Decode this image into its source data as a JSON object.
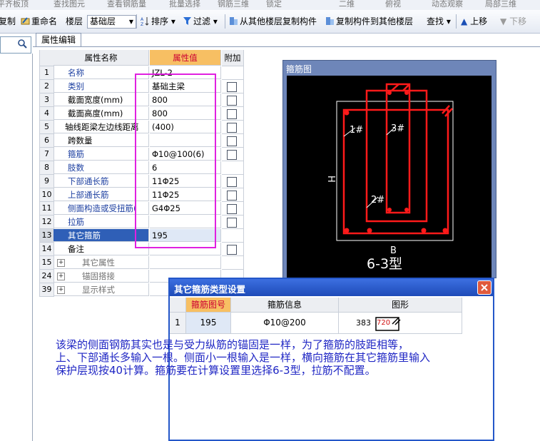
{
  "top_strip": [
    "平齐板顶",
    "查找图元",
    "查看钢筋量",
    "批量选择",
    "钢筋三维",
    "锁定",
    "二维",
    "俯视",
    "动态观察",
    "局部三维"
  ],
  "toolbar": {
    "items": [
      "复制",
      "重命名",
      "楼层",
      "基础层",
      "排序",
      "过滤",
      "从其他楼层复制构件",
      "复制构件到其他楼层",
      "查找",
      "上移",
      "下移"
    ]
  },
  "tab": {
    "label": "属性编辑"
  },
  "grid": {
    "headers": {
      "name": "属性名称",
      "value": "属性值",
      "add": "附加"
    },
    "rows": [
      {
        "num": "1",
        "name": "名称",
        "value": "JZL-2"
      },
      {
        "num": "2",
        "name": "类别",
        "value": "基础主梁"
      },
      {
        "num": "3",
        "name": "截面宽度(mm)",
        "value": "800"
      },
      {
        "num": "4",
        "name": "截面高度(mm)",
        "value": "800"
      },
      {
        "num": "5",
        "name": "轴线距梁左边线距离",
        "value": "(400)"
      },
      {
        "num": "6",
        "name": "跨数量",
        "value": ""
      },
      {
        "num": "7",
        "name": "箍筋",
        "value": "Φ10@100(6)"
      },
      {
        "num": "8",
        "name": "肢数",
        "value": "6"
      },
      {
        "num": "9",
        "name": "下部通长筋",
        "value": "11Φ25"
      },
      {
        "num": "10",
        "name": "上部通长筋",
        "value": "11Φ25"
      },
      {
        "num": "11",
        "name": "侧面构造或受扭筋(",
        "value": "G4Φ25"
      },
      {
        "num": "12",
        "name": "拉筋",
        "value": ""
      },
      {
        "num": "13",
        "name": "其它箍筋",
        "value": "195"
      },
      {
        "num": "14",
        "name": "备注",
        "value": ""
      },
      {
        "num": "15",
        "name": "其它属性",
        "value": ""
      },
      {
        "num": "24",
        "name": "锚固搭接",
        "value": ""
      },
      {
        "num": "39",
        "name": "显示样式",
        "value": ""
      }
    ]
  },
  "diagram": {
    "title": "箍筋图",
    "labels": {
      "l1": "1#",
      "l2": "2#",
      "l3": "3#",
      "h": "H",
      "b": "B",
      "type": "6-3型"
    },
    "stroke_color": "#ff1a1a"
  },
  "dialog": {
    "title": "其它箍筋类型设置",
    "headers": [
      "箍筋图号",
      "箍筋信息",
      "图形"
    ],
    "row": {
      "num": "1",
      "code": "195",
      "info": "Φ10@200",
      "dim1": "383",
      "dim2": "720"
    }
  },
  "note": [
    "该梁的侧面钢筋其实也是与受力纵筋的锚固是一样，为了箍筋的肢距相等，",
    "上、下部通长多输入一根。侧面小一根输入是一样，横向箍筋在其它箍筋里输入",
    "保护层现按40计算。箍筋要在计算设置里选择6-3型，拉筋不配置。"
  ]
}
